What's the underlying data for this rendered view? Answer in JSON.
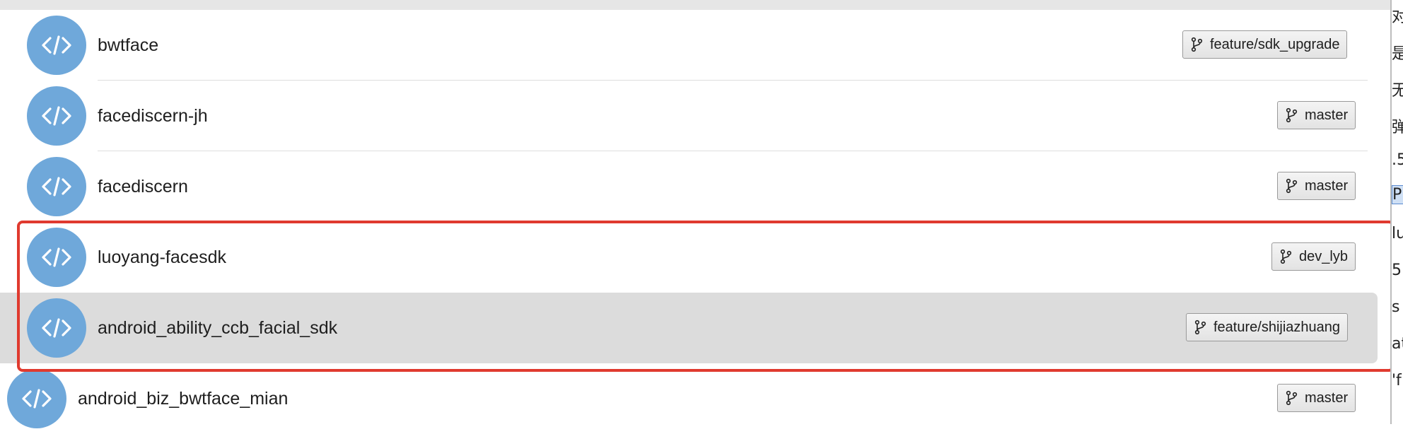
{
  "repos": [
    {
      "name": "bwtface",
      "branch": "feature/sdk_upgrade",
      "selected": false
    },
    {
      "name": "facediscern-jh",
      "branch": "master",
      "selected": false
    },
    {
      "name": "facediscern",
      "branch": "master",
      "selected": false
    },
    {
      "name": "luoyang-facesdk",
      "branch": "dev_lyb",
      "selected": false
    },
    {
      "name": "android_ability_ccb_facial_sdk",
      "branch": "feature/shijiazhuang",
      "selected": true
    },
    {
      "name": "android_biz_bwtface_mian",
      "branch": "master",
      "selected": false
    }
  ],
  "right_panel_glyphs": [
    "对",
    "是",
    "无",
    "弹",
    ".5",
    "P",
    "lu",
    "5",
    "s",
    "at",
    "'f"
  ],
  "colors": {
    "avatar": "#6fa8da",
    "selection": "#dcdcdc",
    "highlight_border": "#e03a2f"
  },
  "icons": {
    "repo": "code-brackets-icon",
    "branch": "git-branch-icon"
  }
}
